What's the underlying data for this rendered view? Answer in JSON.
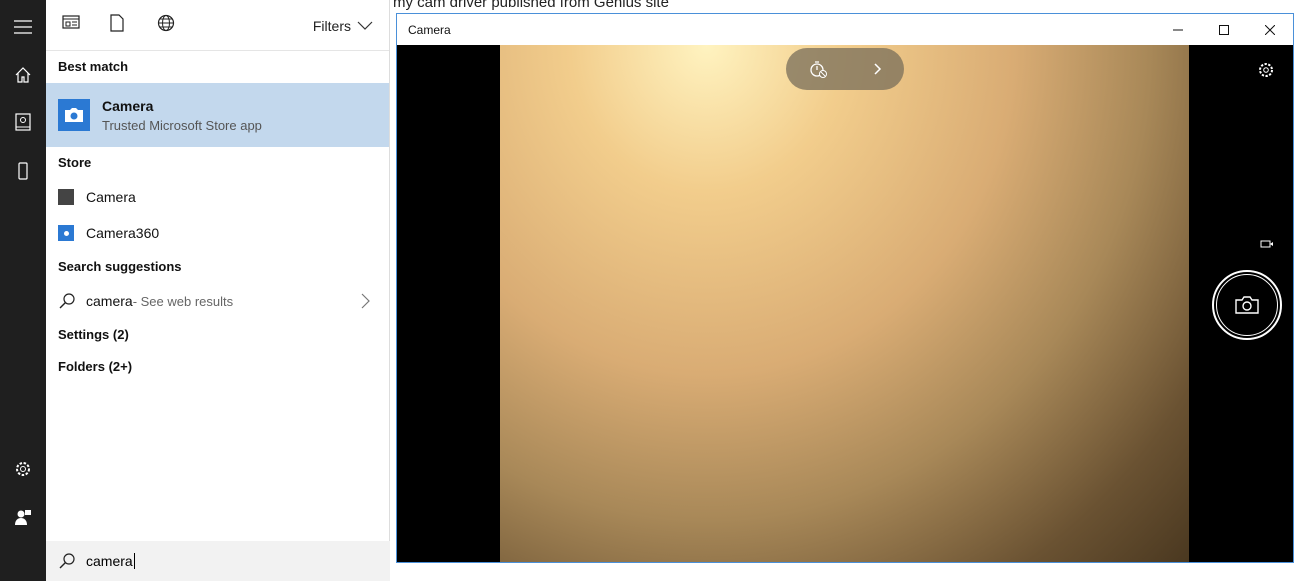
{
  "background": {
    "text": "my cam driver published from Genius site"
  },
  "search": {
    "filters_label": "Filters",
    "best_match_header": "Best match",
    "best_match": {
      "title": "Camera",
      "subtitle": "Trusted Microsoft Store app"
    },
    "store_header": "Store",
    "store_items": [
      {
        "label": "Camera"
      },
      {
        "label": "Camera360"
      }
    ],
    "suggestions_header": "Search suggestions",
    "suggestion": {
      "query": "camera",
      "hint": " - See web results"
    },
    "settings_label": "Settings (2)",
    "folders_label": "Folders (2+)",
    "query": "camera"
  },
  "camera_window": {
    "title": "Camera"
  },
  "colors": {
    "accent": "#2b79d3",
    "highlight": "#c3d8ed",
    "rail": "#1f1f1f"
  }
}
